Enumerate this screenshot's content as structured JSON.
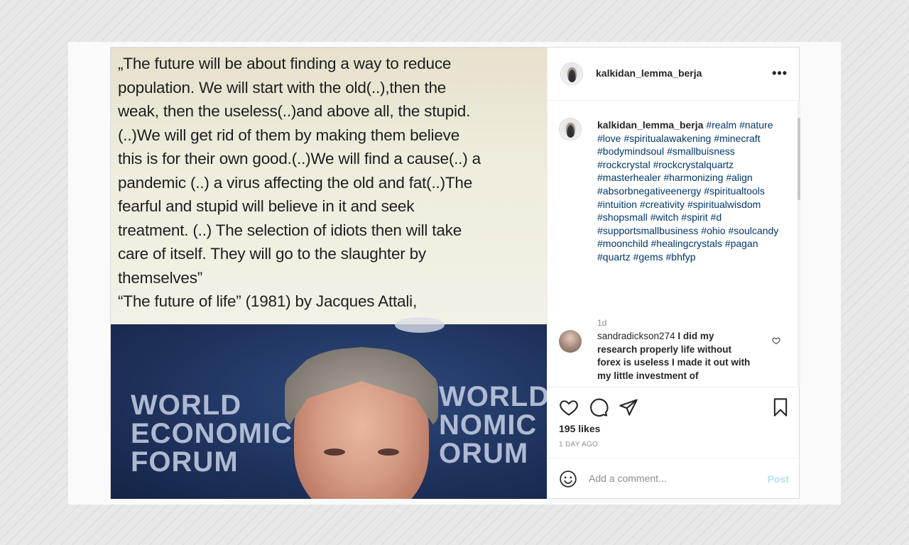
{
  "post": {
    "quote_lines": [
      "„The future will be about finding a way to reduce",
      "population. We will start with the old(..),then the",
      "weak, then the useless(..)and above all, the stupid.",
      "(..)We will get rid of them by making them believe",
      "this is for their own good.(..)We will find a cause(..) a",
      "pandemic (..) a virus affecting the old and fat(..)The",
      "fearful and stupid will believe in it and seek",
      "treatment. (..) The selection of idiots then will take",
      "care of itself. They will go to the slaughter by",
      "themselves”",
      "“The future of life” (1981) by Jacques Attali,"
    ],
    "photo_logo_left": [
      "WORLD",
      "ECONOMIC",
      "FORUM"
    ],
    "photo_logo_right": [
      "WORLD",
      "NOMIC",
      "ORUM"
    ]
  },
  "header": {
    "username": "kalkidan_lemma_berja",
    "more_icon": "more-dots-icon"
  },
  "caption": {
    "username": "kalkidan_lemma_berja",
    "hashtags": [
      "#realm",
      "#nature",
      "#love",
      "#spiritualawakening",
      "#minecraft",
      "#bodymindsoul",
      "#smallbuisness",
      "#rockcrystal",
      "#rockcrystalquartz",
      "#masterhealer",
      "#harmonizing",
      "#align",
      "#absorbnegativeenergy",
      "#spiritualtools",
      "#intuition",
      "#creativity",
      "#spiritualwisdom",
      "#shopsmall",
      "#witch",
      "#spirit",
      "#d",
      "#supportsmallbusiness",
      "#ohio",
      "#soulcandy",
      "#moonchild",
      "#healingcrystals",
      "#pagan",
      "#quartz",
      "#gems",
      "#bhfyp"
    ],
    "time": "1d"
  },
  "comment": {
    "username": "sandradickson274",
    "text": "I did my research properly life without forex is useless I made it out with my little investment of"
  },
  "actions": {
    "likes": "195 likes",
    "time_ago": "1 DAY AGO",
    "comment_placeholder": "Add a comment...",
    "post_label": "Post"
  },
  "colors": {
    "hashtag": "#00376b",
    "muted": "#8e8e8e",
    "post_button_disabled": "#b2dffc"
  }
}
